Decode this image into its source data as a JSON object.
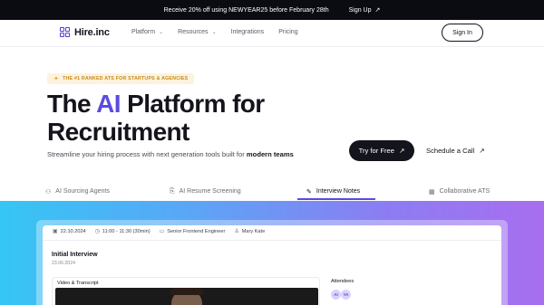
{
  "promo": {
    "text": "Receive 20% off using NEWYEAR25 before February 28th",
    "signup_label": "Sign Up",
    "signup_arrow": "↗"
  },
  "nav": {
    "logo_text": "Hire.inc",
    "items": [
      {
        "label": "Platform",
        "has_dropdown": true
      },
      {
        "label": "Resources",
        "has_dropdown": true
      },
      {
        "label": "Integrations",
        "has_dropdown": false
      },
      {
        "label": "Pricing",
        "has_dropdown": false
      }
    ],
    "chevron": "⌄",
    "signin_label": "Sign In"
  },
  "hero": {
    "badge_icon": "✦",
    "badge_text": "THE #1 RANKED ATS FOR STARTUPS & AGENCIES",
    "headline_pre": "The ",
    "headline_accent": "AI",
    "headline_post": " Platform for",
    "headline_line2": "Recruitment",
    "subtitle_pre": "Streamline your hiring process with next generation tools built for ",
    "subtitle_bold": "modern teams",
    "cta_primary": "Try for Free",
    "cta_secondary": "Schedule a Call",
    "arrow": "↗"
  },
  "tabs": [
    {
      "label": "AI Sourcing Agents",
      "icon": "users-icon",
      "glyph": "⚇",
      "active": false
    },
    {
      "label": "AI Resume Screening",
      "icon": "resume-icon",
      "glyph": "⎘",
      "active": false
    },
    {
      "label": "Interview Notes",
      "icon": "pencil-icon",
      "glyph": "✎",
      "active": true
    },
    {
      "label": "Collaborative ATS",
      "icon": "board-icon",
      "glyph": "▦",
      "active": false
    }
  ],
  "mockup": {
    "date": "22.10.2024",
    "time": "11:00 - 11:30 (30min)",
    "role": "Senior Frontend Engineer",
    "person": "Mary Kate",
    "title": "Initial Interview",
    "sub_date": "23.06.2024",
    "video_label": "Video & Transcript",
    "attendees_label": "Attendees",
    "attendees": [
      "AI",
      "YA"
    ]
  },
  "colors": {
    "accent": "#5a4bdf",
    "dark": "#14141c",
    "badge_bg": "#fdf3dd",
    "badge_text": "#c78a1a"
  }
}
